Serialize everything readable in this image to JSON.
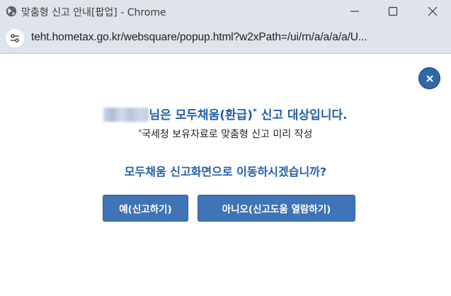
{
  "window": {
    "title": "맞춤형 신고 안내[팝업] - Chrome"
  },
  "address_bar": {
    "url": "teht.hometax.go.kr/websquare/popup.html?w2xPath=/ui/rn/a/a/a/a/U..."
  },
  "dialog": {
    "headline_suffix": "님은 모두채움(환급)",
    "headline_mark": "*",
    "headline_tail": " 신고 대상입니다.",
    "note_mark": "*",
    "note_text": "국세청 보유자료로 맞춤형 신고 미리 작성",
    "question": "모두채움 신고화면으로 이동하시겠습니까?",
    "yes_label": "예(신고하기)",
    "no_label": "아니오(신고도움 열람하기)"
  },
  "colors": {
    "accent": "#2160a6",
    "button": "#3f74b6",
    "chrome_frame": "#dfe3ea"
  },
  "icons": {
    "title": "globe-icon",
    "site_info": "tune-icon",
    "minimize": "minimize-icon",
    "maximize": "maximize-icon",
    "close": "close-icon",
    "dialog_close": "close-icon"
  }
}
